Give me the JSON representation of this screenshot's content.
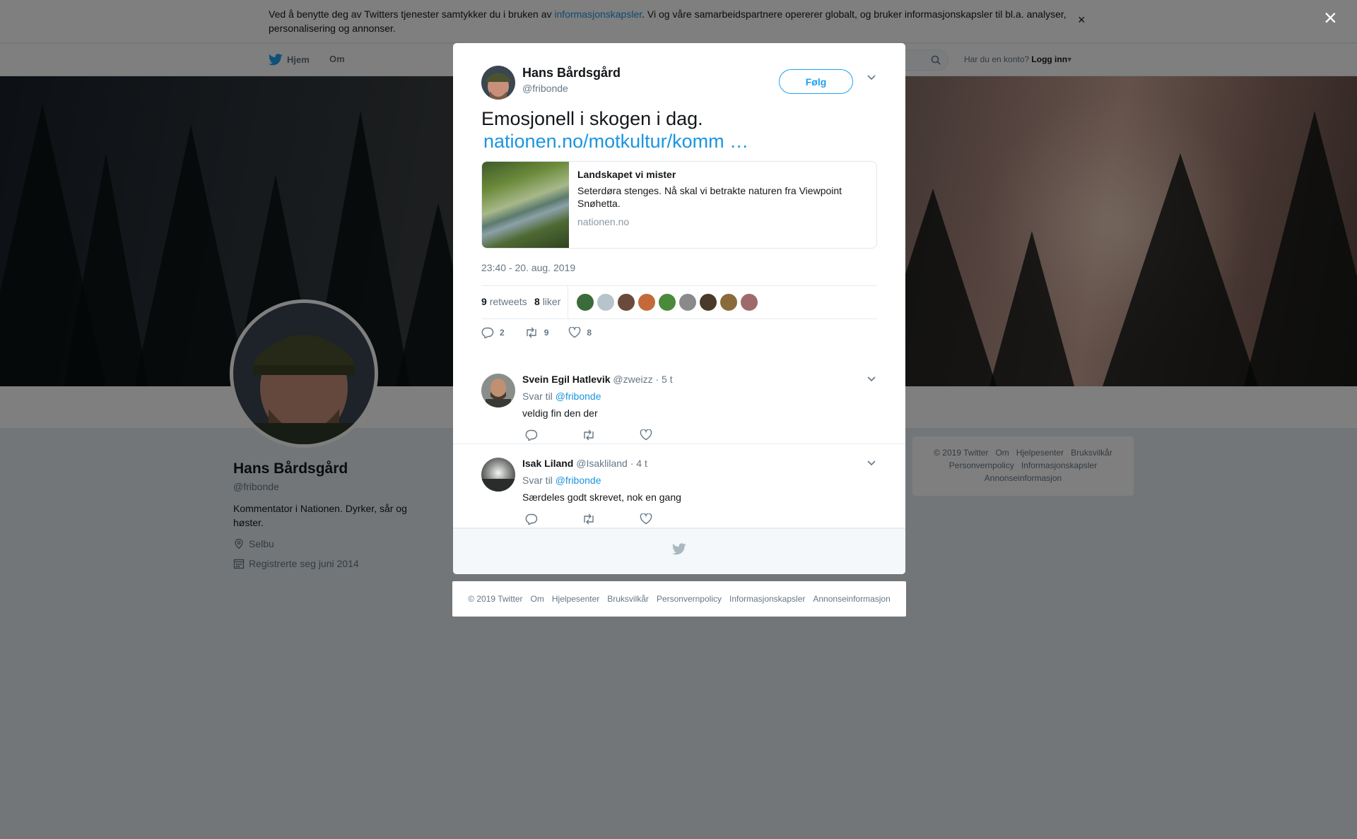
{
  "cookie_bar": {
    "text_before": "Ved å benytte deg av Twitters tjenester samtykker du i bruken av ",
    "link": "informasjonskapsler",
    "text_after": ". Vi og våre samarbeidspartnere opererer globalt, og bruker informasjonskapsler til bl.a. analyser, personalisering og annonser.",
    "close": "×"
  },
  "nav": {
    "home": "Hjem",
    "about": "Om",
    "account_prompt": "Har du en konto?",
    "login": "Logg inn"
  },
  "profile": {
    "name": "Hans Bårdsgård",
    "handle": "@fribonde",
    "bio": "Kommentator i Nationen. Dyrker, sår og høster.",
    "location": "Selbu",
    "joined": "Registrerte seg juni 2014"
  },
  "side_footer": {
    "items": [
      "© 2019 Twitter",
      "Om",
      "Hjelpesenter",
      "Bruksvilkår",
      "Personvernpolicy",
      "Informasjonskapsler",
      "Annonseinformasjon"
    ]
  },
  "overlay": {
    "close": "×"
  },
  "tweet": {
    "author_name": "Hans Bårdsgård",
    "author_handle": "@fribonde",
    "follow_label": "Følg",
    "text": "Emosjonell i skogen i dag.",
    "link": "nationen.no/motkultur/komm …",
    "card": {
      "title": "Landskapet vi mister",
      "description": "Seterdøra stenges. Nå skal vi betrakte naturen fra Viewpoint Snøhetta.",
      "domain": "nationen.no"
    },
    "timestamp": "23:40 - 20. aug. 2019",
    "retweet_count": "9",
    "retweet_label": "retweets",
    "like_count": "8",
    "like_label": "liker",
    "likers": [
      "#3a6b3a",
      "#b8c4cc",
      "#6a4a3a",
      "#c46a3a",
      "#4a8a3a",
      "#8a8a8a",
      "#4a3a2a",
      "#8a6a3a",
      "#a06a6a"
    ],
    "reply_count": "2",
    "action_retweets": "9",
    "action_likes": "8"
  },
  "replies": [
    {
      "name": "Svein Egil Hatlevik",
      "handle": "@zweizz",
      "time": "· 5 t",
      "to_label": "Svar til",
      "mention": "@fribonde",
      "text": "veldig fin den der"
    },
    {
      "name": "Isak Liland",
      "handle": "@Isakliland",
      "time": "· 4 t",
      "to_label": "Svar til",
      "mention": "@fribonde",
      "text": "Særdeles godt skrevet, nok en gang"
    }
  ],
  "bottom_footer": {
    "items": [
      "© 2019 Twitter",
      "Om",
      "Hjelpesenter",
      "Bruksvilkår",
      "Personvernpolicy",
      "Informasjonskapsler",
      "Annonseinformasjon"
    ]
  },
  "colors": {
    "accent": "#1da1f2",
    "link": "#1b95e0",
    "text": "#14171a",
    "muted": "#657786"
  }
}
